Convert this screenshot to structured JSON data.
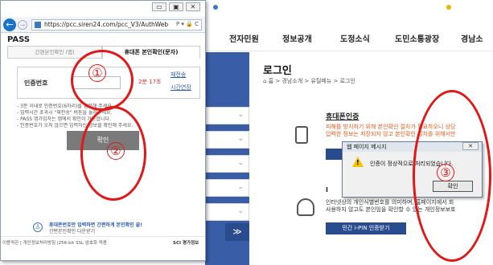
{
  "background_page": {
    "nav": [
      "전자민원",
      "정보공개",
      "도정소식",
      "도민소통광장",
      "경남소"
    ],
    "login_title": "로그인",
    "breadcrumb": "⌂ 홈 > 경남소개 > 유틸메뉴 > 로그인",
    "phone_auth": {
      "title": "휴대폰인증",
      "desc_line1": "피해를 방지하기 위해 본인확인 절차가 필요하오니 상당",
      "desc_line2": "입력한 정보는 저장되지 않고 본인확인 절차를 위해서만"
    },
    "ipin": {
      "head": "I",
      "desc_line1": "인터넷상의 개인식별번호를 의미하며, 홈페이지에서 회",
      "desc_line2": "사용하지 않고도 본인임을 확인할 수 있는 개인정보보호",
      "button": "민간 i-PIN 인증받기"
    },
    "sidebar_bottom_icon": "double-chevron-down-icon",
    "sidebar_bottom_glyph": "≫",
    "accent_color": "#2a4b8e"
  },
  "popup": {
    "address_url": "https://pcc.siren24.com/pcc_V3/AuthWeb",
    "address_tail": "P ▾ 🔒 C",
    "window_controls": [
      "▭",
      "▣",
      "✕"
    ],
    "pass_label": "PASS",
    "tab_simple": "간편본인확인 (앱)",
    "tab_sms": "휴대폰 본인확인(문자)",
    "auth_label": "인증번호",
    "timer": "2분 17초",
    "resend": "재전송",
    "extend": "시간연장",
    "notes": [
      "- 3분 이내로 인증번호(6자리)를 입력해 주세요.",
      "- 입력시간 초과시 \"재전송\" 버튼을 눌러주세요.",
      "- PASS 앱가입자는 앱에서 확인이 가능합니다.",
      "- 인증번호가 오지 않으면 입력하신 정보를 확인해 주세요."
    ],
    "confirm": "확인",
    "promo_line1": "휴대폰번호만 입력하면 간편하게 본인확인 끝!",
    "promo_line2": "간편본인확인 다운받기",
    "footer": "이용약관 | 개인정보처리방침 |256-bit SSL 암호화 적용",
    "footer_brand": "SCI 평가정보"
  },
  "alert": {
    "title": "웹 페이지 메시지",
    "message": "인증이 정상적으로 처리되었습니다.",
    "ok": "확인",
    "close": "✕"
  },
  "annotations": {
    "one": "①",
    "two": "②",
    "three": "③",
    "color": "#e01818"
  }
}
